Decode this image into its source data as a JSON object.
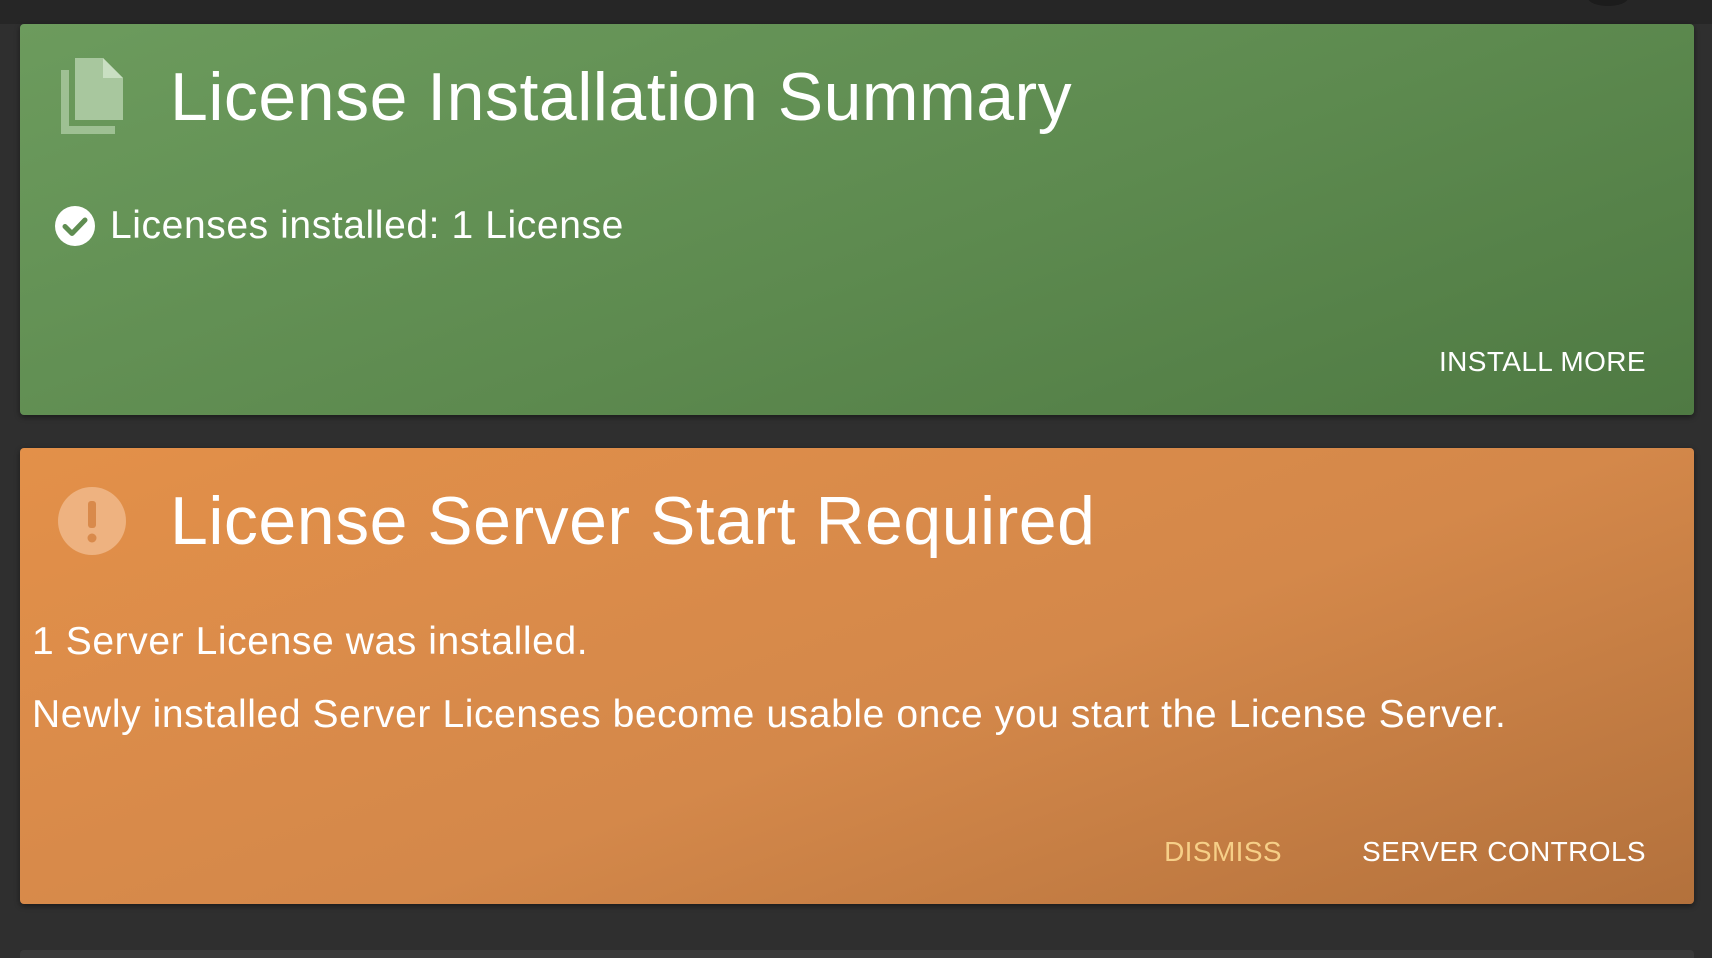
{
  "colors": {
    "background": "#2f2f2f",
    "success_card": "#639255",
    "warning_card": "#d8894a",
    "dismiss_text": "#f6cf88",
    "text": "#ffffff"
  },
  "license_summary_card": {
    "icon": "file-copy-icon",
    "title": "License Installation Summary",
    "status_icon": "check-circle-icon",
    "status_text": "Licenses installed: 1 License",
    "actions": {
      "install_more_label": "INSTALL MORE"
    }
  },
  "server_start_card": {
    "icon": "alert-circle-icon",
    "title": "License Server Start Required",
    "lines": [
      "1 Server License was installed.",
      "Newly installed Server Licenses become usable once you start the License Server."
    ],
    "actions": {
      "dismiss_label": "DISMISS",
      "server_controls_label": "SERVER CONTROLS"
    }
  }
}
